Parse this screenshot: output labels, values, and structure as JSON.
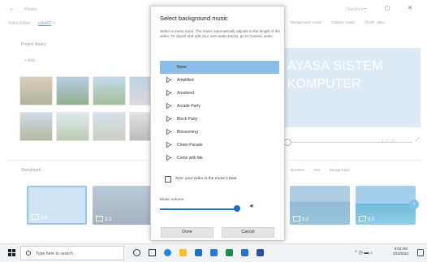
{
  "app": {
    "title": "Photos",
    "breadcrumb_root": "Video Editor",
    "project_name": "coba02",
    "onedrive": "OneDrive",
    "window_controls": "–  ▢  ✕",
    "toolbar": [
      "Background music",
      "Custom audio",
      "Finish video"
    ],
    "project_library": "Project library",
    "add_label": "+ Add",
    "preview_line1": "AYASA SISTEM",
    "preview_line2": "KOMPUTER",
    "timecode": "1:27.00",
    "storyboard": "Storyboard",
    "storyboard_tools": [
      "Duration",
      "Text",
      "Background"
    ],
    "clips": [
      {
        "duration": "3.0"
      },
      {
        "duration": "3.0"
      },
      {
        "duration": "3.0"
      },
      {
        "duration": "3.0"
      }
    ]
  },
  "dialog": {
    "title": "Select background music",
    "description": "Select a music track. The music automatically adjusts to the length of the video. To import and add your own audio tracks, go to Custom audio.",
    "tracks": [
      "None",
      "Amplified",
      "Anodized",
      "Arcade Party",
      "Block Party",
      "Blossoming",
      "Clown Parade",
      "Come with Me"
    ],
    "selected_track": "None",
    "sync_label": "Sync your video to the music's beat",
    "sync_checked": false,
    "volume_label": "Music volume",
    "volume_level": 0.9,
    "done_label": "Done",
    "cancel_label": "Cancel"
  },
  "taskbar": {
    "search_placeholder": "Type here to search",
    "time": "8:02 AM",
    "date": "3/10/2022",
    "icons": [
      "task-view-icon",
      "edge-icon",
      "file-explorer-icon",
      "mail-icon",
      "store-icon",
      "excel-icon",
      "photos-icon",
      "word-icon"
    ]
  },
  "colors": {
    "accent": "#1d6fc4",
    "selected_track": "#8bbde8",
    "preview_bg": "#cfe1f0"
  }
}
